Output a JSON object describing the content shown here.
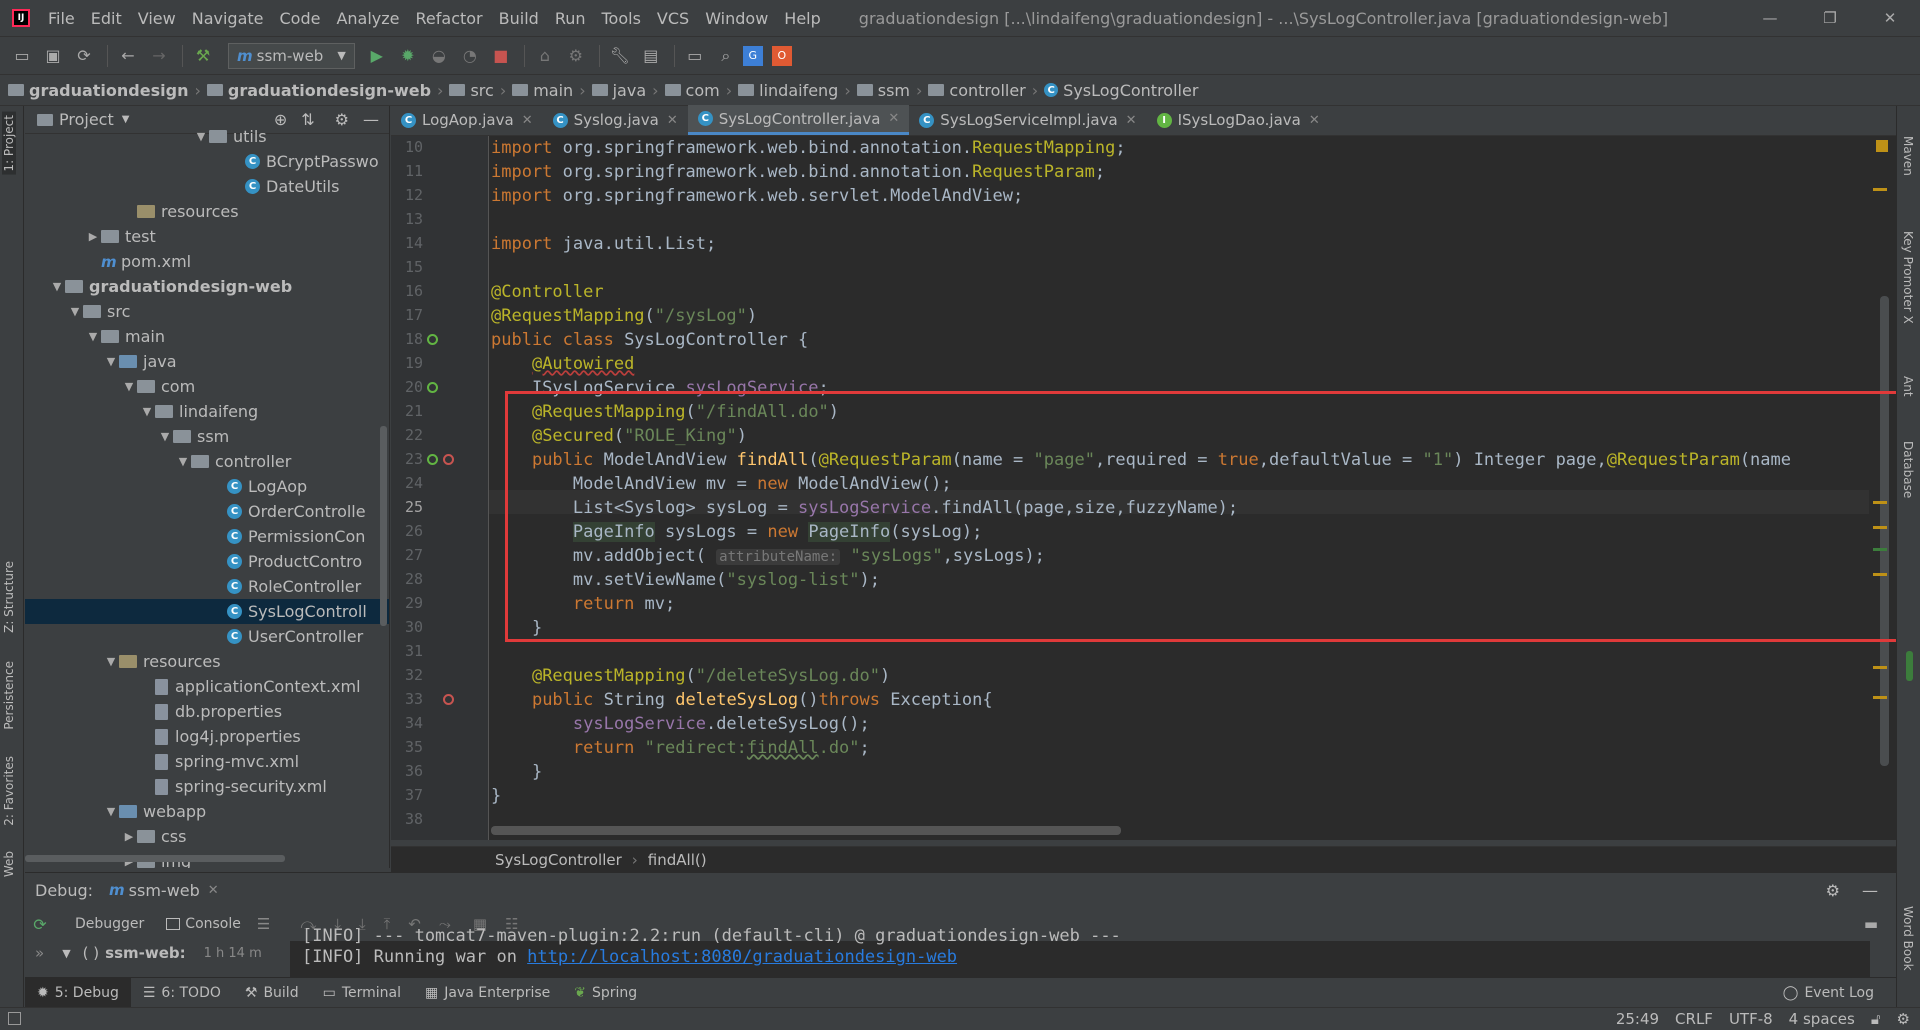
{
  "window": {
    "title": "graduationdesign [...\\lindaifeng\\graduationdesign] - ...\\SysLogController.java [graduationdesign-web]",
    "menu": [
      "File",
      "Edit",
      "View",
      "Navigate",
      "Code",
      "Analyze",
      "Refactor",
      "Build",
      "Run",
      "Tools",
      "VCS",
      "Window",
      "Help"
    ]
  },
  "toolbar": {
    "run_config": "ssm-web"
  },
  "navbar": {
    "crumbs": [
      "graduationdesign",
      "graduationdesign-web",
      "src",
      "main",
      "java",
      "com",
      "lindaifeng",
      "ssm",
      "controller",
      "SysLogController"
    ]
  },
  "left_strip": {
    "labels": [
      "1: Project",
      "Z: Structure",
      "Persistence",
      "2: Favorites",
      "Web"
    ]
  },
  "right_strip": {
    "labels": [
      "Maven",
      "Key Promoter X",
      "Ant",
      "Database",
      "Word Book"
    ]
  },
  "project": {
    "title": "Project",
    "rows": [
      {
        "text": "utils",
        "indent": 9
      },
      {
        "text": "BCryptPasswo",
        "indent": 11
      },
      {
        "text": "DateUtils",
        "indent": 11
      },
      {
        "text": "resources",
        "indent": 5
      },
      {
        "text": "test",
        "indent": 3
      },
      {
        "text": "pom.xml",
        "indent": 3
      },
      {
        "text": "graduationdesign-web",
        "indent": 1
      },
      {
        "text": "src",
        "indent": 2
      },
      {
        "text": "main",
        "indent": 3
      },
      {
        "text": "java",
        "indent": 4
      },
      {
        "text": "com",
        "indent": 5
      },
      {
        "text": "lindaifeng",
        "indent": 6
      },
      {
        "text": "ssm",
        "indent": 7
      },
      {
        "text": "controller",
        "indent": 8
      },
      {
        "text": "LogAop",
        "indent": 10
      },
      {
        "text": "OrderControlle",
        "indent": 10
      },
      {
        "text": "PermissionCon",
        "indent": 10
      },
      {
        "text": "ProductContro",
        "indent": 10
      },
      {
        "text": "RoleController",
        "indent": 10
      },
      {
        "text": "SysLogControll",
        "indent": 10
      },
      {
        "text": "UserController",
        "indent": 10
      },
      {
        "text": "resources",
        "indent": 4
      },
      {
        "text": "applicationContext.xml",
        "indent": 6
      },
      {
        "text": "db.properties",
        "indent": 6
      },
      {
        "text": "log4j.properties",
        "indent": 6
      },
      {
        "text": "spring-mvc.xml",
        "indent": 6
      },
      {
        "text": "spring-security.xml",
        "indent": 6
      },
      {
        "text": "webapp",
        "indent": 4
      },
      {
        "text": "css",
        "indent": 5
      },
      {
        "text": "img",
        "indent": 5
      }
    ]
  },
  "tabs": [
    "LogAop.java",
    "Syslog.java",
    "SysLogController.java",
    "SysLogServiceImpl.java",
    "ISysLogDao.java"
  ],
  "editor": {
    "line_numbers": [
      "10",
      "11",
      "12",
      "13",
      "14",
      "15",
      "16",
      "17",
      "18",
      "19",
      "20",
      "21",
      "22",
      "23",
      "24",
      "25",
      "26",
      "27",
      "28",
      "29",
      "30",
      "31",
      "32",
      "33",
      "34",
      "35",
      "36",
      "37",
      "38"
    ],
    "current_line": "25",
    "breadcrumb": [
      "SysLogController",
      "findAll()"
    ]
  },
  "debug": {
    "label": "Debug:",
    "config": "ssm-web",
    "tabs": [
      "Debugger",
      "Console"
    ],
    "session": "ssm-web:",
    "session_time": "1 h 14 m",
    "console_line1": "[INFO] --- tomcat7-maven-plugin:2.2:run (default-cli) @ graduationdesign-web ---",
    "console_prefix": "[INFO] Running war on ",
    "console_link": "http://localhost:8080/graduationdesign-web"
  },
  "bottom_tools": [
    "5: Debug",
    "6: TODO",
    "Build",
    "Terminal",
    "Java Enterprise",
    "Spring"
  ],
  "event_log": "Event Log",
  "status": {
    "position": "25:49",
    "line_sep": "CRLF",
    "encoding": "UTF-8",
    "indent": "4 spaces"
  },
  "colors": {
    "highlight_box": "#e03a3a",
    "accent": "#4a88c7"
  }
}
